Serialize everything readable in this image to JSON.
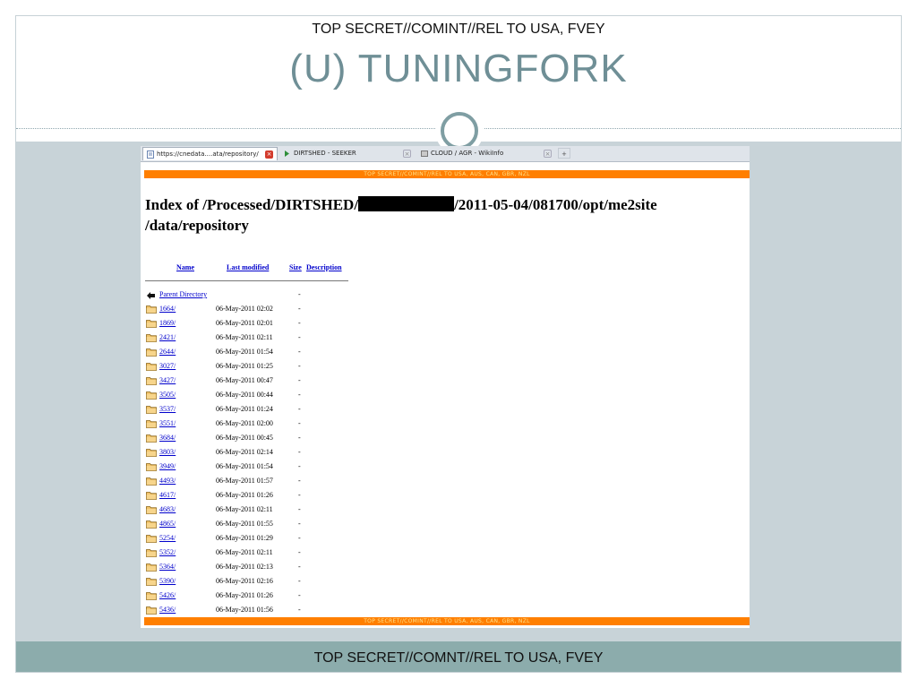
{
  "slide": {
    "classification_top": "TOP SECRET//COMINT//REL TO USA, FVEY",
    "title": "(U) TUNINGFORK",
    "classification_bottom": "TOP SECRET//COMNT//REL TO USA, FVEY"
  },
  "browser": {
    "tabs": [
      {
        "label": "https://cnedata....ata/repository/",
        "icon": "page-icon",
        "active": true
      },
      {
        "label": "DIRTSHED - SEEKER",
        "icon": "arrow-icon",
        "active": false
      },
      {
        "label": "CLOUD / AGR - WikiInfo",
        "icon": "wiki-icon",
        "active": false
      }
    ],
    "new_tab_label": "+"
  },
  "page": {
    "banner": "TOP SECRET//COMINT//REL TO USA, AUS, CAN, GBR, NZL",
    "heading_part1": "Index of /Processed/DIRTSHED/",
    "heading_part2": "/2011-05-04/081700/opt/me2site",
    "heading_line2": "/data/repository",
    "columns": {
      "name": "Name",
      "last_modified": "Last modified",
      "size": "Size",
      "description": "Description"
    },
    "parent": {
      "label": "Parent Directory",
      "size": "-"
    },
    "rows": [
      {
        "name": "1664/",
        "date": "06-May-2011 02:02",
        "size": "-"
      },
      {
        "name": "1869/",
        "date": "06-May-2011 02:01",
        "size": "-"
      },
      {
        "name": "2421/",
        "date": "06-May-2011 02:11",
        "size": "-"
      },
      {
        "name": "2644/",
        "date": "06-May-2011 01:54",
        "size": "-"
      },
      {
        "name": "3027/",
        "date": "06-May-2011 01:25",
        "size": "-"
      },
      {
        "name": "3427/",
        "date": "06-May-2011 00:47",
        "size": "-"
      },
      {
        "name": "3505/",
        "date": "06-May-2011 00:44",
        "size": "-"
      },
      {
        "name": "3537/",
        "date": "06-May-2011 01:24",
        "size": "-"
      },
      {
        "name": "3551/",
        "date": "06-May-2011 02:00",
        "size": "-"
      },
      {
        "name": "3684/",
        "date": "06-May-2011 00:45",
        "size": "-"
      },
      {
        "name": "3803/",
        "date": "06-May-2011 02:14",
        "size": "-"
      },
      {
        "name": "3949/",
        "date": "06-May-2011 01:54",
        "size": "-"
      },
      {
        "name": "4493/",
        "date": "06-May-2011 01:57",
        "size": "-"
      },
      {
        "name": "4617/",
        "date": "06-May-2011 01:26",
        "size": "-"
      },
      {
        "name": "4683/",
        "date": "06-May-2011 02:11",
        "size": "-"
      },
      {
        "name": "4865/",
        "date": "06-May-2011 01:55",
        "size": "-"
      },
      {
        "name": "5254/",
        "date": "06-May-2011 01:29",
        "size": "-"
      },
      {
        "name": "5352/",
        "date": "06-May-2011 02:11",
        "size": "-"
      },
      {
        "name": "5364/",
        "date": "06-May-2011 02:13",
        "size": "-"
      },
      {
        "name": "5390/",
        "date": "06-May-2011 02:16",
        "size": "-"
      },
      {
        "name": "5426/",
        "date": "06-May-2011 01:26",
        "size": "-"
      },
      {
        "name": "5436/",
        "date": "06-May-2011 01:56",
        "size": "-"
      }
    ]
  },
  "colors": {
    "title": "#6f8f96",
    "banner_bg": "#ff7f00",
    "banner_text": "#ffe08a",
    "link": "#0000cc",
    "slide_body": "#c8d3d8",
    "slide_footer": "#8cacac"
  }
}
